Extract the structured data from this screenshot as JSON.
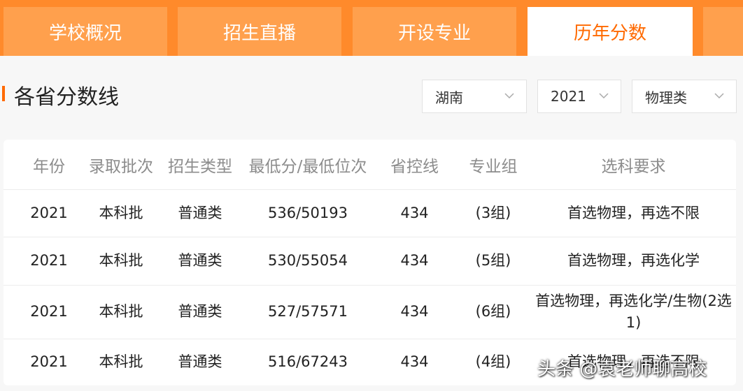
{
  "tabs": [
    {
      "label": "学校概况"
    },
    {
      "label": "招生直播"
    },
    {
      "label": "开设专业"
    },
    {
      "label": "历年分数"
    }
  ],
  "section": {
    "title": "各省分数线"
  },
  "filters": {
    "province": "湖南",
    "year": "2021",
    "category": "物理类"
  },
  "table": {
    "headers": [
      "年份",
      "录取批次",
      "招生类型",
      "最低分/最低位次",
      "省控线",
      "专业组",
      "选科要求"
    ],
    "rows": [
      [
        "2021",
        "本科批",
        "普通类",
        "536/50193",
        "434",
        "(3组)",
        "首选物理，再选不限"
      ],
      [
        "2021",
        "本科批",
        "普通类",
        "530/55054",
        "434",
        "(5组)",
        "首选物理，再选化学"
      ],
      [
        "2021",
        "本科批",
        "普通类",
        "527/57571",
        "434",
        "(6组)",
        "首选物理，再选化学/生物(2选1)"
      ],
      [
        "2021",
        "本科批",
        "普通类",
        "516/67243",
        "434",
        "(4组)",
        "首选物理，再选不限"
      ]
    ]
  },
  "watermark": "头条 @袁老师聊高校",
  "colors": {
    "accent": "#ff6a00",
    "tab_bar": "#ff8a2b",
    "tab": "#ffa04d"
  }
}
